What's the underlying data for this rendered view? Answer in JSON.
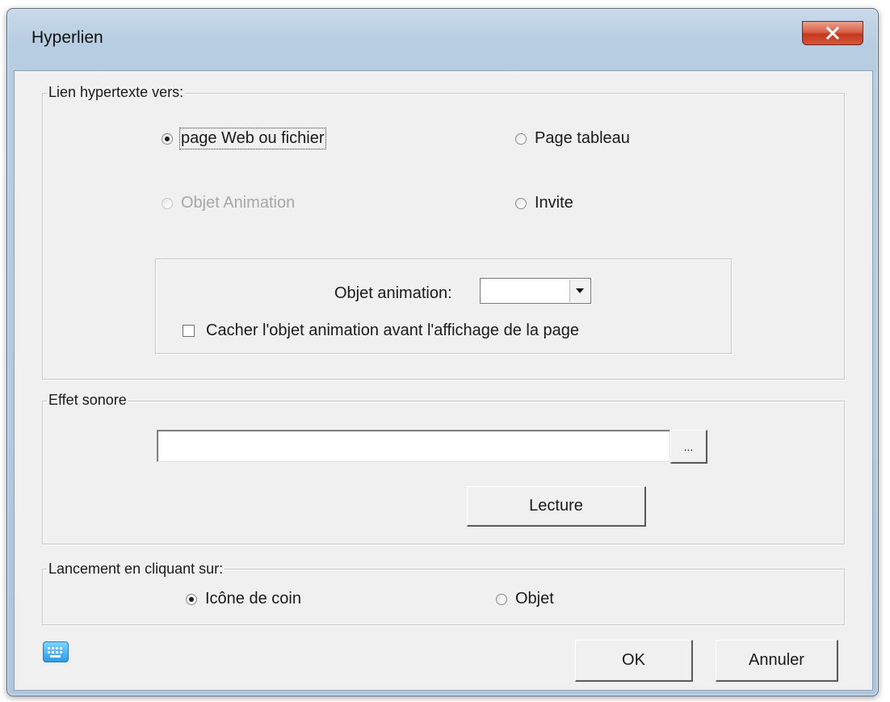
{
  "window": {
    "title": "Hyperlien"
  },
  "link_group": {
    "label": "Lien hypertexte vers:",
    "options": {
      "web_page": {
        "label": "page Web ou fichier",
        "checked": true
      },
      "page_tableau": {
        "label": "Page tableau",
        "checked": false
      },
      "objet_animation": {
        "label": "Objet Animation",
        "checked": false,
        "disabled": true
      },
      "invite": {
        "label": "Invite",
        "checked": false
      }
    },
    "animation": {
      "label": "Objet animation:",
      "selected_value": "",
      "hide_label": "Cacher l'objet animation avant l'affichage de la page",
      "hide_checked": false
    }
  },
  "sound_group": {
    "label": "Effet sonore",
    "path_value": "",
    "browse_label": "...",
    "play_label": "Lecture"
  },
  "launch_group": {
    "label": "Lancement en cliquant sur:",
    "options": {
      "corner_icon": {
        "label": "Icône de coin",
        "checked": true
      },
      "object": {
        "label": "Objet",
        "checked": false
      }
    }
  },
  "footer": {
    "ok_label": "OK",
    "cancel_label": "Annuler",
    "keyboard_icon": "keyboard-icon"
  },
  "colors": {
    "close_button": "#c3381f",
    "dialog_background": "#f0f0f0",
    "title_bar": "#b7cde2"
  }
}
